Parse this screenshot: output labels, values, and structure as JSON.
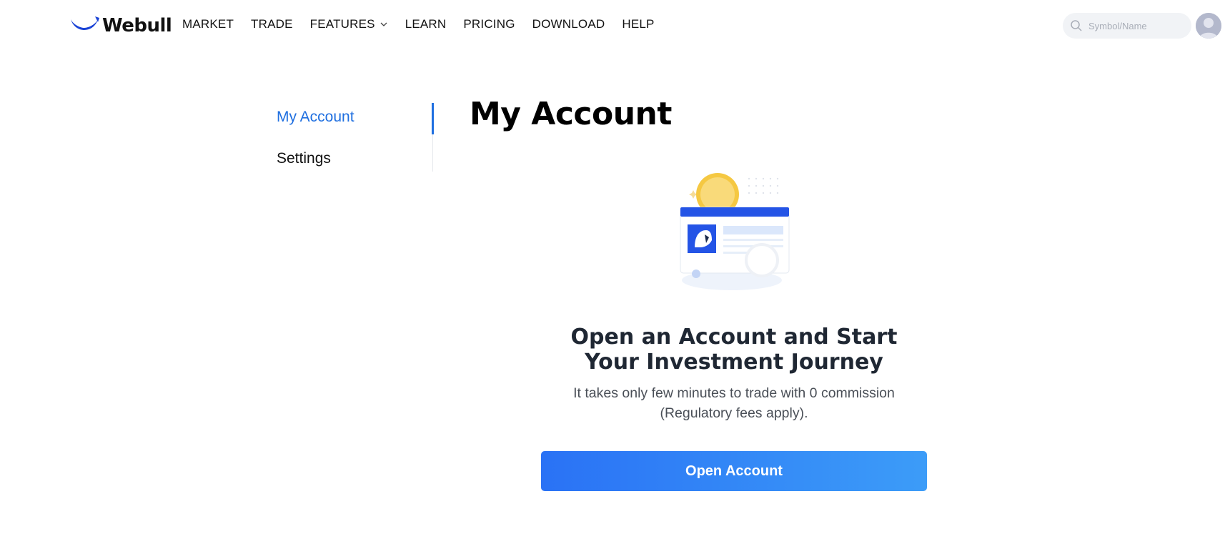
{
  "header": {
    "logo_text": "Webull",
    "nav": [
      {
        "label": "MARKET"
      },
      {
        "label": "TRADE"
      },
      {
        "label": "FEATURES"
      },
      {
        "label": "LEARN"
      },
      {
        "label": "PRICING"
      },
      {
        "label": "DOWNLOAD"
      },
      {
        "label": "HELP"
      }
    ],
    "search": {
      "placeholder": "Symbol/Name",
      "value": ""
    }
  },
  "sidebar": {
    "items": [
      {
        "label": "My Account",
        "active": true
      },
      {
        "label": "Settings",
        "active": false
      }
    ]
  },
  "main": {
    "title": "My Account",
    "promo_title": "Open an Account and Start Your Investment Journey",
    "promo_subtitle": "It takes only few minutes to trade with 0 commission (Regulatory fees apply).",
    "button_label": "Open Account"
  },
  "colors": {
    "brand_blue": "#1f6fe0",
    "button_gradient_start": "#2a72f5",
    "button_gradient_end": "#3c9cf8"
  },
  "icons": {
    "logo": "webull-logo-icon",
    "features_dropdown": "chevron-down-icon",
    "search": "search-icon",
    "avatar": "user-avatar-icon"
  }
}
